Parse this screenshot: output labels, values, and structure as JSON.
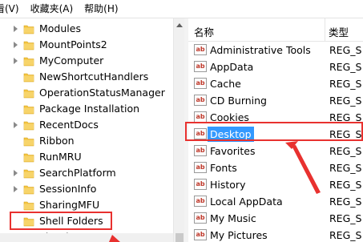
{
  "menu": [
    "看(V)",
    "收藏夹(A)",
    "帮助(H)"
  ],
  "tree": {
    "items": [
      {
        "label": "Modules",
        "expandable": true
      },
      {
        "label": "MountPoints2",
        "expandable": true
      },
      {
        "label": "MyComputer",
        "expandable": true
      },
      {
        "label": "NewShortcutHandlers",
        "expandable": false
      },
      {
        "label": "OperationStatusManager",
        "expandable": false
      },
      {
        "label": "Package Installation",
        "expandable": false
      },
      {
        "label": "RecentDocs",
        "expandable": true
      },
      {
        "label": "Ribbon",
        "expandable": false
      },
      {
        "label": "RunMRU",
        "expandable": false
      },
      {
        "label": "SearchPlatform",
        "expandable": true
      },
      {
        "label": "SessionInfo",
        "expandable": true
      },
      {
        "label": "SharingMFU",
        "expandable": false
      },
      {
        "label": "Shell Folders",
        "expandable": false
      },
      {
        "label": "Shutdown",
        "expandable": false
      }
    ]
  },
  "list": {
    "col_name": "名称",
    "col_type": "类型",
    "rows": [
      {
        "name": "Administrative Tools",
        "type": "REG_S"
      },
      {
        "name": "AppData",
        "type": "REG_S"
      },
      {
        "name": "Cache",
        "type": "REG_S"
      },
      {
        "name": "CD Burning",
        "type": "REG_S"
      },
      {
        "name": "Cookies",
        "type": "REG_S"
      },
      {
        "name": "Desktop",
        "type": "REG_S"
      },
      {
        "name": "Favorites",
        "type": "REG_S"
      },
      {
        "name": "Fonts",
        "type": "REG_S"
      },
      {
        "name": "History",
        "type": "REG_S"
      },
      {
        "name": "Local AppData",
        "type": "REG_S"
      },
      {
        "name": "My Music",
        "type": "REG_S"
      },
      {
        "name": "My Pictures",
        "type": "REG_S"
      }
    ],
    "icon_text": "ab"
  },
  "colors": {
    "highlight": "#e8312f",
    "selection": "#3399ff",
    "folder": "#f4c542"
  }
}
